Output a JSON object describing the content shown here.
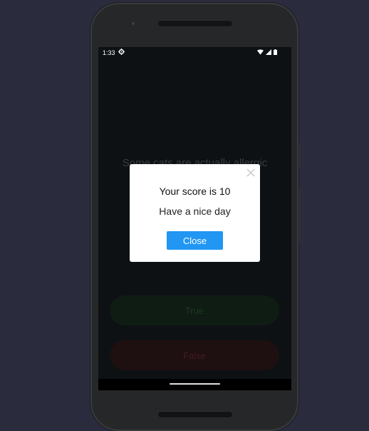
{
  "status_bar": {
    "time": "1:33",
    "settings_icon": "gear-icon",
    "wifi_icon": "wifi-icon",
    "signal_icon": "cell-signal-icon",
    "battery_icon": "battery-icon"
  },
  "quiz": {
    "question": "Some cats are actually allergic",
    "true_label": "True",
    "false_label": "False"
  },
  "dialog": {
    "title": "Your score is 10",
    "message": "Have a nice day",
    "close_label": "Close",
    "close_icon": "close-icon"
  },
  "colors": {
    "background": "#2a2b3d",
    "screen_background": "#0d1114",
    "dialog_button": "#2196f3",
    "true_button": "#0f1c13",
    "false_button": "#1e0f11"
  }
}
